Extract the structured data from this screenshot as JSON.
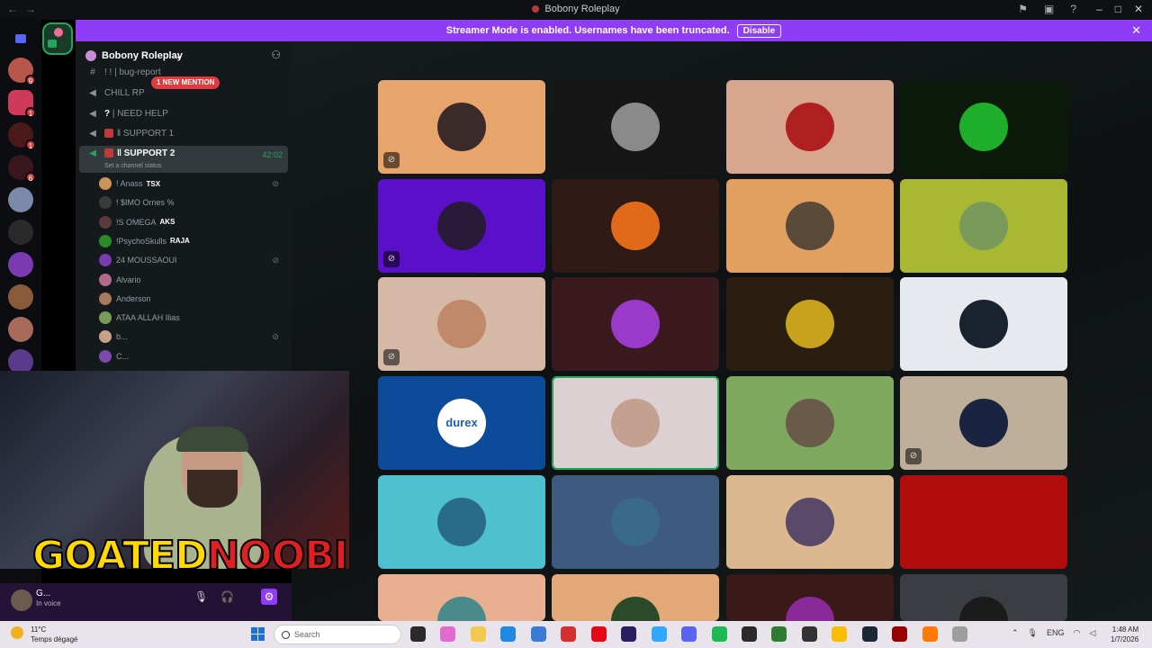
{
  "window": {
    "title": "Bobony Roleplay"
  },
  "banner": {
    "text": "Streamer Mode is enabled. Usernames have been truncated.",
    "disable_label": "Disable"
  },
  "server": {
    "name": "Bobony Roleplay",
    "mention_pill": "1 NEW MENTION"
  },
  "rail_badges": [
    "9",
    "1",
    "1",
    "6"
  ],
  "channels": [
    {
      "label": "bug-report",
      "icon": "text-channel-icon"
    },
    {
      "label": "CHILL RP",
      "icon": "speaker-icon"
    },
    {
      "label": "NEED HELP",
      "icon": "speaker-icon"
    },
    {
      "label": "SUPPORT 1",
      "icon": "speaker-icon"
    },
    {
      "label": "SUPPORT 2",
      "icon": "speaker-icon",
      "time": "42:02",
      "status": "Set a channel status"
    }
  ],
  "voice_users": [
    {
      "name": "! Anass",
      "clan": "TSX",
      "muted": true
    },
    {
      "name": "! $IMO Ornes %",
      "clan": "",
      "muted": false
    },
    {
      "name": "!S OMEGA",
      "clan": "AKS",
      "muted": false
    },
    {
      "name": "!PsychoSkulls",
      "clan": "RAJA",
      "muted": false
    },
    {
      "name": "24 MOUSSAOUI",
      "clan": "",
      "muted": true
    },
    {
      "name": "Alvario",
      "clan": "",
      "muted": false
    },
    {
      "name": "Anderson",
      "clan": "",
      "muted": false
    },
    {
      "name": "ATAA ALLAH Ilias",
      "clan": "",
      "muted": false
    },
    {
      "name": "b...",
      "clan": "",
      "muted": true
    },
    {
      "name": "C...",
      "clan": "",
      "muted": false
    }
  ],
  "tiles": [
    {
      "bg": "#e8a56b",
      "avatar": "#3a2a2a",
      "muted": true
    },
    {
      "bg": "#161616",
      "avatar": "#8a8a8a",
      "muted": false
    },
    {
      "bg": "#d8a58e",
      "avatar": "#b02020",
      "muted": false
    },
    {
      "bg": "#0c1a0c",
      "avatar": "#1fae2a",
      "muted": false
    },
    {
      "bg": "#5a0fc8",
      "avatar": "#2a1a3a",
      "muted": true
    },
    {
      "bg": "#2f1a16",
      "avatar": "#e06a1a",
      "muted": false
    },
    {
      "bg": "#e2a060",
      "avatar": "#5a4a3a",
      "muted": false
    },
    {
      "bg": "#a8b832",
      "avatar": "#7a9a5a",
      "muted": false
    },
    {
      "bg": "#d6b8a6",
      "avatar": "#c08a6a",
      "muted": true
    },
    {
      "bg": "#3a1a1e",
      "avatar": "#9a3aca",
      "muted": false
    },
    {
      "bg": "#2a1e10",
      "avatar": "#c8a21a",
      "muted": false
    },
    {
      "bg": "#e6eaee",
      "avatar": "#1a2230",
      "muted": false
    },
    {
      "bg": "#0e4a9a",
      "avatar": "#ffffff",
      "muted": false,
      "label": "durex"
    },
    {
      "bg": "#ddd0d2",
      "avatar": "#c4a090",
      "muted": false,
      "speaking": true
    },
    {
      "bg": "#7ea85e",
      "avatar": "#6a5a4a",
      "muted": false
    },
    {
      "bg": "#bfae9a",
      "avatar": "#1a2440",
      "muted": true
    },
    {
      "bg": "#4ec0d0",
      "avatar": "#2a6a8a",
      "muted": false
    },
    {
      "bg": "#3f5a80",
      "avatar": "#3a6a8a",
      "muted": false
    },
    {
      "bg": "#dcb890",
      "avatar": "#5a4a6a",
      "muted": false
    },
    {
      "bg": "#b00c0c",
      "avatar": "#b00c0c",
      "muted": false
    },
    {
      "bg": "#e8b090",
      "avatar": "#4a8a8a",
      "muted": false
    },
    {
      "bg": "#e2a878",
      "avatar": "#2a4a2a",
      "muted": false
    },
    {
      "bg": "#3a1a18",
      "avatar": "#8a2a9a",
      "muted": false
    },
    {
      "bg": "#3a3e42",
      "avatar": "#1a1a1a",
      "muted": false
    }
  ],
  "webcam": {
    "overlay_a": "GOATED",
    "overlay_b": "NOOBIE"
  },
  "user": {
    "name": "G...",
    "status": "In voice"
  },
  "taskbar": {
    "temperature": "11°C",
    "weather": "Temps dégagé",
    "search_placeholder": "Search",
    "lang": "ENG",
    "time": "1:48 AM",
    "date": "1/7/2026"
  },
  "colors": {
    "accent": "#8e3cf5",
    "speaking": "#23a55a",
    "mention": "#e03b3f"
  }
}
